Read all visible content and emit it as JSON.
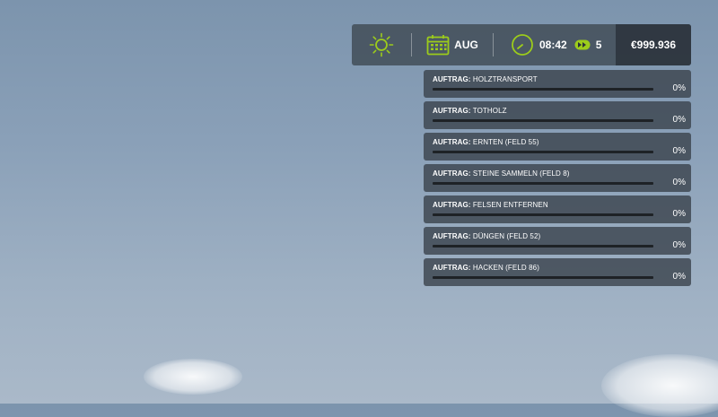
{
  "hud": {
    "month": "AUG",
    "time": "08:42",
    "speed": "5",
    "money": "€999.936",
    "accent_color": "#9ccc1b"
  },
  "missions": [
    {
      "label": "AUFTRAG:",
      "name": "HOLZTRANSPORT",
      "progress": "0%",
      "progress_value": 0
    },
    {
      "label": "AUFTRAG:",
      "name": "TOTHOLZ",
      "progress": "0%",
      "progress_value": 0
    },
    {
      "label": "AUFTRAG:",
      "name": "ERNTEN (FELD 55)",
      "progress": "0%",
      "progress_value": 0
    },
    {
      "label": "AUFTRAG:",
      "name": "STEINE SAMMELN (FELD 8)",
      "progress": "0%",
      "progress_value": 0
    },
    {
      "label": "AUFTRAG:",
      "name": "FELSEN ENTFERNEN",
      "progress": "0%",
      "progress_value": 0
    },
    {
      "label": "AUFTRAG:",
      "name": "DÜNGEN (FELD 52)",
      "progress": "0%",
      "progress_value": 0
    },
    {
      "label": "AUFTRAG:",
      "name": "HACKEN (FELD 86)",
      "progress": "0%",
      "progress_value": 0
    }
  ]
}
